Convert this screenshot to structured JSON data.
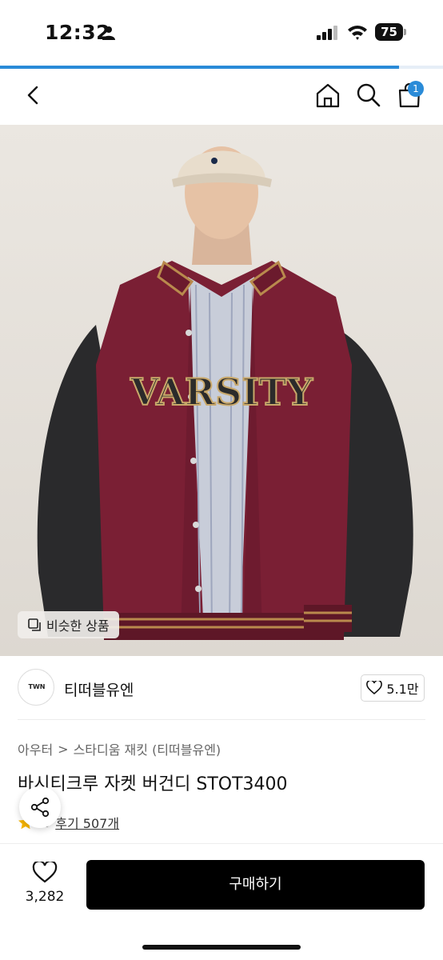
{
  "status_bar": {
    "time": "12:32",
    "battery": "75"
  },
  "page_load_progress": 0.9,
  "nav": {
    "cart_count": "1"
  },
  "product": {
    "similar_label": "비슷한 상품",
    "brand_logo_text": "TWN",
    "brand_name": "티떠블유엔",
    "likes": "5.1만",
    "breadcrumb": [
      "아우터",
      ">",
      "스타디움 재킷 (티떠블유엔)"
    ],
    "title": "바시티크루 자켓 버건디 STOT3400",
    "rating": ".9",
    "reviews": "후기 507개",
    "jacket_lettering": "VARSITY"
  },
  "bottom": {
    "wish_count": "3,282",
    "buy_label": "구매하기"
  },
  "colors": {
    "accent": "#2a8bd8",
    "burgundy": "#7a1f34",
    "star": "#f7b500"
  },
  "icons": [
    "person-icon",
    "signal-icon",
    "wifi-icon",
    "back-icon",
    "home-icon",
    "search-icon",
    "cart-icon",
    "copy-icon",
    "heart-icon",
    "star-icon",
    "share-icon"
  ]
}
